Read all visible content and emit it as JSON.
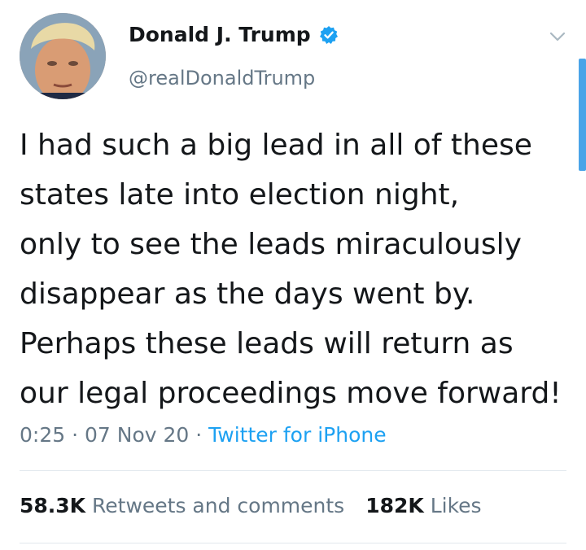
{
  "profile": {
    "display_name": "Donald J. Trump",
    "handle": "@realDonaldTrump",
    "verified": true
  },
  "tweet": {
    "lines": [
      "I had such a big lead in all of these",
      "states late into election night,",
      "only to see the leads miraculously",
      "disappear as the days went by.",
      "Perhaps these leads will return as",
      "our legal proceedings move forward!"
    ],
    "time": "0:25",
    "date": "07 Nov 20",
    "separator": " · ",
    "source": "Twitter for iPhone"
  },
  "stats": {
    "retweets_count": "58.3K",
    "retweets_label": " Retweets and comments",
    "likes_count": "182K",
    "likes_label": " Likes"
  },
  "icons": {
    "verified": "verified-badge-icon",
    "caret": "chevron-down-icon"
  },
  "colors": {
    "accent": "#1da1f2",
    "secondary_text": "#657786",
    "primary_text": "#14171a",
    "divider": "#e1e8ed",
    "scrollbar": "#4aa4e8"
  }
}
